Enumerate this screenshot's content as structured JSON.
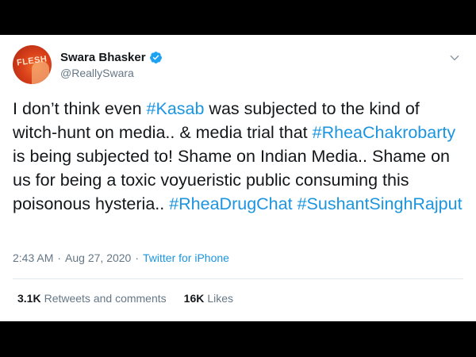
{
  "user": {
    "avatar_text": "FLESH",
    "display_name": "Swara Bhasker",
    "handle": "@ReallySwara",
    "verified_icon": "verified-badge-icon"
  },
  "tweet": {
    "segments": [
      {
        "text": "I don’t think even ",
        "type": "text"
      },
      {
        "text": "#Kasab",
        "type": "hashtag"
      },
      {
        "text": " was subjected to the kind of witch-hunt on media.. & media trial that ",
        "type": "text"
      },
      {
        "text": "#RheaChakrobarty",
        "type": "hashtag"
      },
      {
        "text": " is being subjected to! Shame on Indian Media.. Shame on us for being a toxic voyueristic public consuming this poisonous hysteria.. ",
        "type": "text"
      },
      {
        "text": "#RheaDrugChat",
        "type": "hashtag"
      },
      {
        "text": " ",
        "type": "text"
      },
      {
        "text": "#SushantSinghRajput",
        "type": "hashtag"
      }
    ]
  },
  "meta": {
    "time": "2:43 AM",
    "separator": "·",
    "date": "Aug 27, 2020",
    "source": "Twitter for iPhone"
  },
  "stats": {
    "retweets_count": "3.1K",
    "retweets_label": "Retweets and comments",
    "likes_count": "16K",
    "likes_label": "Likes"
  },
  "colors": {
    "link": "#1b95e0",
    "text": "#14171a",
    "secondary": "#657786",
    "verified": "#1da1f2",
    "background": "#000000"
  }
}
